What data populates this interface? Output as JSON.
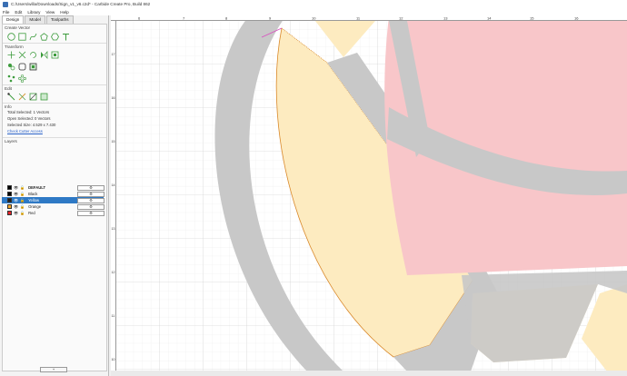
{
  "window": {
    "title": "C:/Users/willa/Downloads/Sign_v1_v6.c2d* - Carbide Create Pro, Build 862"
  },
  "menu": [
    "File",
    "Edit",
    "Library",
    "View",
    "Help"
  ],
  "tabs": [
    "Design",
    "Model",
    "Toolpaths"
  ],
  "sections": {
    "create_vector": "Create Vector",
    "transform": "Transform",
    "edit": "Edit",
    "info": "Info",
    "layers": "Layers"
  },
  "info": {
    "total_selected": "Total Selected:  1 Vectors",
    "open_selected": "Open Selected:  0 Vectors",
    "selected_size": "Selected Size:   4.529 x 7.430",
    "check_cutter": "Check Cutter Access"
  },
  "layers": [
    {
      "name": "DEFAULT",
      "color": "#000000",
      "bold": true,
      "selected": false
    },
    {
      "name": "Black",
      "color": "#000000",
      "bold": false,
      "selected": false
    },
    {
      "name": "Yellow",
      "color": "#1e1e1e",
      "bold": false,
      "selected": true
    },
    {
      "name": "Orange",
      "color": "#f5a623",
      "bold": false,
      "selected": false
    },
    {
      "name": "Red",
      "color": "#e8242a",
      "bold": false,
      "selected": false
    }
  ],
  "layer_gear_symbol": "⚙",
  "add_layer_label": "+",
  "ruler": {
    "top_ticks": [
      "6",
      "7",
      "8",
      "9",
      "10",
      "11",
      "12",
      "13",
      "14",
      "15",
      "16"
    ],
    "left_ticks": [
      "17",
      "16",
      "15",
      "14",
      "13",
      "12",
      "11",
      "10"
    ]
  },
  "colors": {
    "grey_band": "#c8c8c8",
    "yellow": "#fdebc0",
    "red": "#f8c6c9",
    "selection_orange": "#d9892b",
    "accent_blue": "#2e79c5"
  }
}
